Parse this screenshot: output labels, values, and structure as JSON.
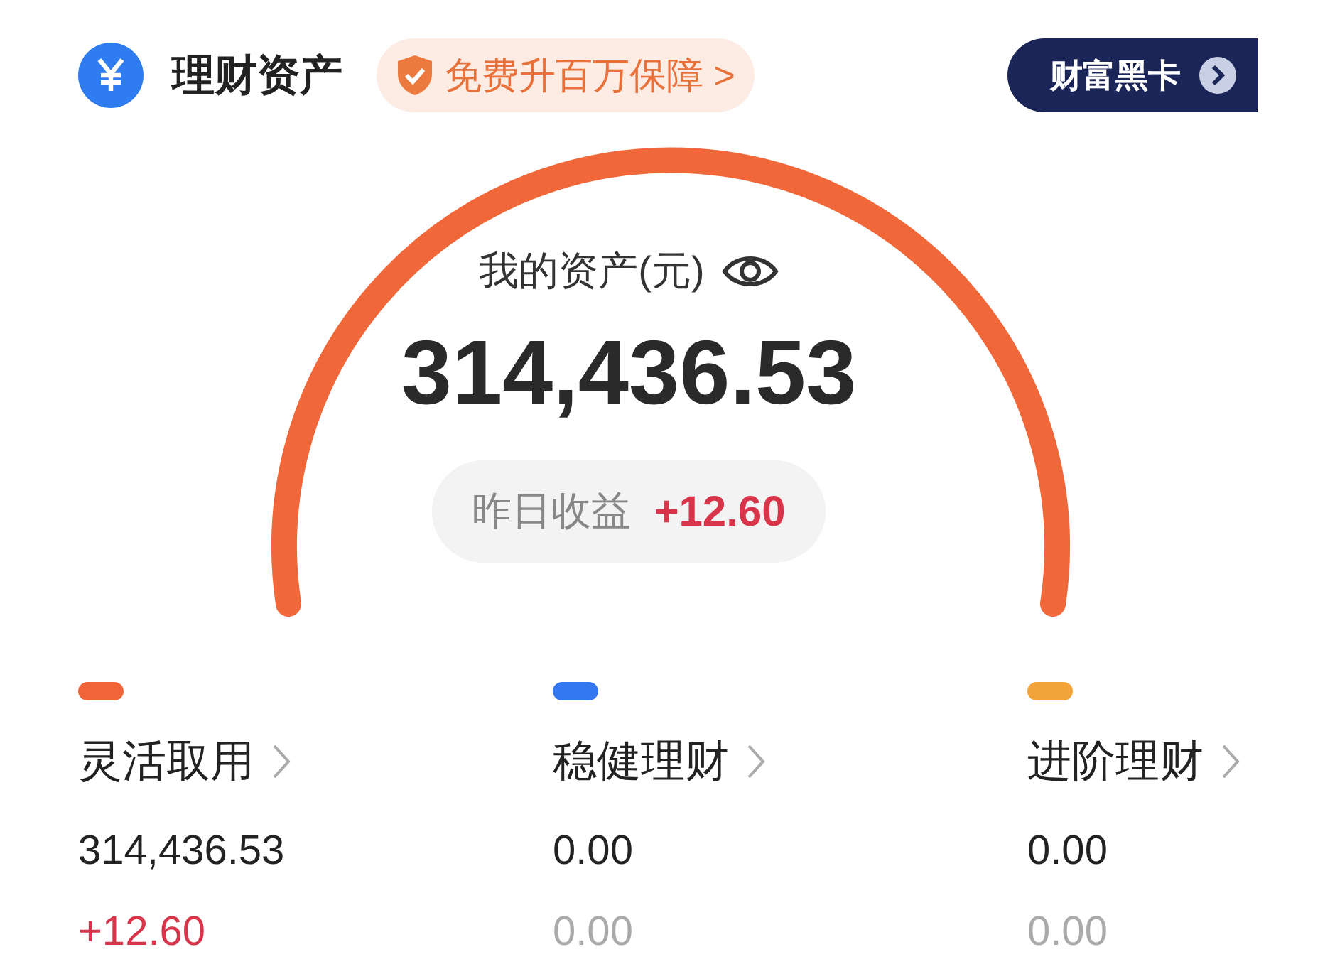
{
  "header": {
    "title": "理财资产",
    "badge": "免费升百万保障 >",
    "card_button": "财富黑卡"
  },
  "summary": {
    "label": "我的资产(元)",
    "total": "314,436.53",
    "yesterday_label": "昨日收益",
    "yesterday_value": "+12.60"
  },
  "categories": [
    {
      "name": "灵活取用",
      "color": "#f0643a",
      "amount": "314,436.53",
      "earnings": "+12.60",
      "positive": true
    },
    {
      "name": "稳健理财",
      "color": "#3478f0",
      "amount": "0.00",
      "earnings": "0.00",
      "positive": false
    },
    {
      "name": "进阶理财",
      "color": "#f2a43a",
      "amount": "0.00",
      "earnings": "0.00",
      "positive": false
    }
  ]
}
